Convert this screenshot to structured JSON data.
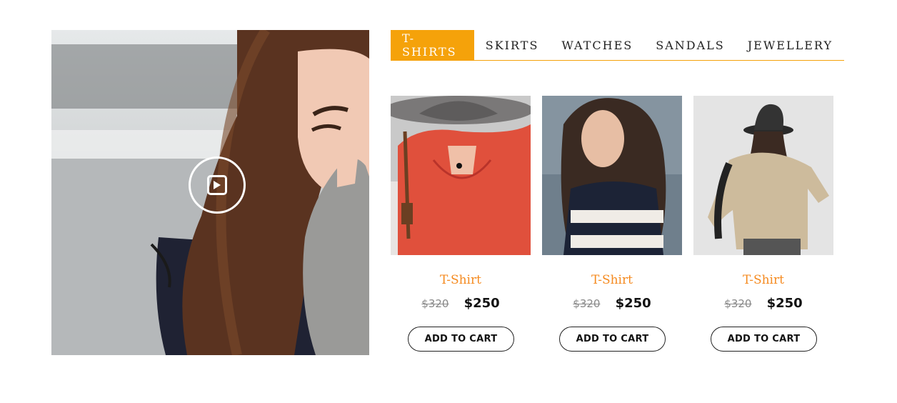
{
  "hero": {
    "image": "woman-laughing-winter-video-thumbnail",
    "play_icon": "play-icon"
  },
  "tabs": [
    {
      "label": "T-SHIRTS",
      "active": true
    },
    {
      "label": "SKIRTS",
      "active": false
    },
    {
      "label": "WATCHES",
      "active": false
    },
    {
      "label": "SANDALS",
      "active": false
    },
    {
      "label": "JEWELLERY",
      "active": false
    }
  ],
  "products": [
    {
      "name": "T-Shirt",
      "old_price": "$320",
      "price": "$250",
      "cta": "ADD TO CART",
      "image": "woman-red-blouse-grey-hat"
    },
    {
      "name": "T-Shirt",
      "old_price": "$320",
      "price": "$250",
      "cta": "ADD TO CART",
      "image": "woman-long-hair-striped-top"
    },
    {
      "name": "T-Shirt",
      "old_price": "$320",
      "price": "$250",
      "cta": "ADD TO CART",
      "image": "woman-beige-sweater-black-hat"
    }
  ],
  "colors": {
    "accent": "#f5a20a",
    "product_name": "#f58a1f",
    "text_dark": "#111111",
    "old_price": "#888888"
  }
}
